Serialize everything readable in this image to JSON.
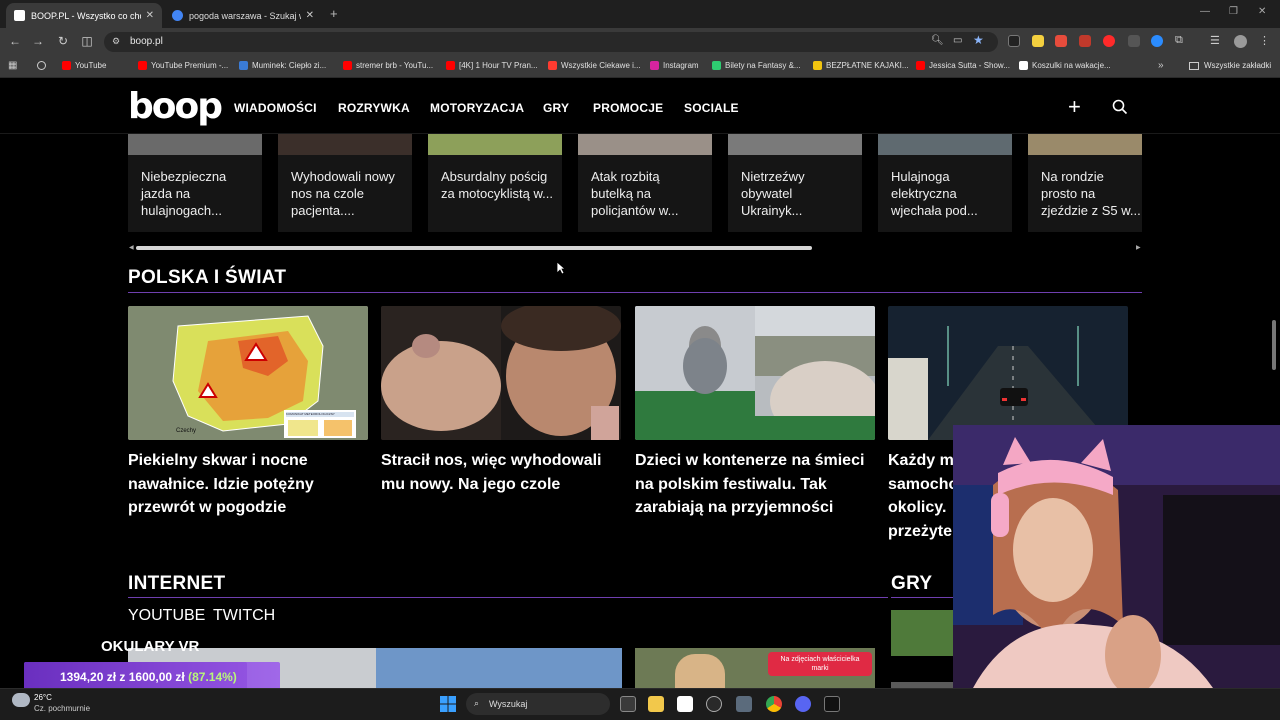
{
  "browser": {
    "tabs": [
      {
        "title": "BOOP.PL - Wszystko co chcesz"
      },
      {
        "title": "pogoda warszawa - Szukaj w Go"
      }
    ],
    "new_tab": "+",
    "url": "boop.pl",
    "bookmarks": [
      {
        "label": "YouTube",
        "color": "#ff0000"
      },
      {
        "label": "YouTube Premium -...",
        "color": "#ff0000"
      },
      {
        "label": "Muminek: Ciepło zi...",
        "color": "#3a7bd5"
      },
      {
        "label": "stremer brb - YouTu...",
        "color": "#ff0000"
      },
      {
        "label": "[4K] 1 Hour TV Pran...",
        "color": "#ff0000"
      },
      {
        "label": "Wszystkie Ciekawe i...",
        "color": "#ff3b30"
      },
      {
        "label": "Instagram",
        "color": "#d6249f"
      },
      {
        "label": "Bilety na Fantasy &...",
        "color": "#2ecc71"
      },
      {
        "label": "BEZPŁATNE KAJAKI...",
        "color": "#f1c40f"
      },
      {
        "label": "Jessica Sutta - Show...",
        "color": "#ff0000"
      },
      {
        "label": "Koszulki na wakacje...",
        "color": "#ffffff"
      }
    ],
    "all_bookmarks": "Wszystkie zakładki",
    "more": "»"
  },
  "site": {
    "logo": "boop",
    "nav": [
      "WIADOMOŚCI",
      "ROZRYWKA",
      "MOTORYZACJA",
      "GRY",
      "PROMOCJE",
      "SOCIALE"
    ]
  },
  "carousel": [
    {
      "caption": "Niebezpieczna jazda na hulajnogach..."
    },
    {
      "caption": "Wyhodowali nowy nos na czole pacjenta...."
    },
    {
      "caption": "Absurdalny pościg za motocyklistą w..."
    },
    {
      "caption": "Atak rozbitą butelką na policjantów w..."
    },
    {
      "caption": "Nietrzeźwy obywatel Ukrainyk..."
    },
    {
      "caption": "Hulajnoga elektryczna wjechała pod..."
    },
    {
      "caption": "Na rondzie prosto na zjeździe z S5 w..."
    }
  ],
  "sections": {
    "polska": {
      "title": "POLSKA I ŚWIAT",
      "articles": [
        {
          "title": "Piekielny skwar i nocne nawałnice. Idzie potężny przewrót w pogodzie"
        },
        {
          "title": "Stracił nos, więc wyhodowali mu nowy. Na jego czole"
        },
        {
          "title": "Dzieci w kontenerze na śmieci na polskim festiwalu. Tak zarabiają na przyjemności"
        },
        {
          "title": "Każdy m samochc okolicy. przeżyte"
        }
      ],
      "map_caption": "KOMUNIKAT METEOROLOGICZNY",
      "map_country": "Czechy"
    },
    "internet": {
      "title": "INTERNET",
      "subnav": [
        "YOUTUBE",
        "TWITCH"
      ],
      "badge": "Na zdjęciach właścicielka marki"
    },
    "gry": {
      "title": "GRY"
    }
  },
  "overlay": {
    "vr_label": "OKULARY VR",
    "donation_current": "1394,20 zł",
    "donation_sep": " z ",
    "donation_goal": "1600,00 zł",
    "donation_pct": "(87.14%)",
    "donation_fraction": 0.8714
  },
  "taskbar": {
    "temperature": "26°C",
    "weather": "Cz. pochmurnie",
    "search": "Wyszukaj"
  },
  "colors": {
    "accent": "#6f3fb0",
    "donation_bar": "#8a4fdc",
    "donation_pct": "#b9f77a"
  }
}
